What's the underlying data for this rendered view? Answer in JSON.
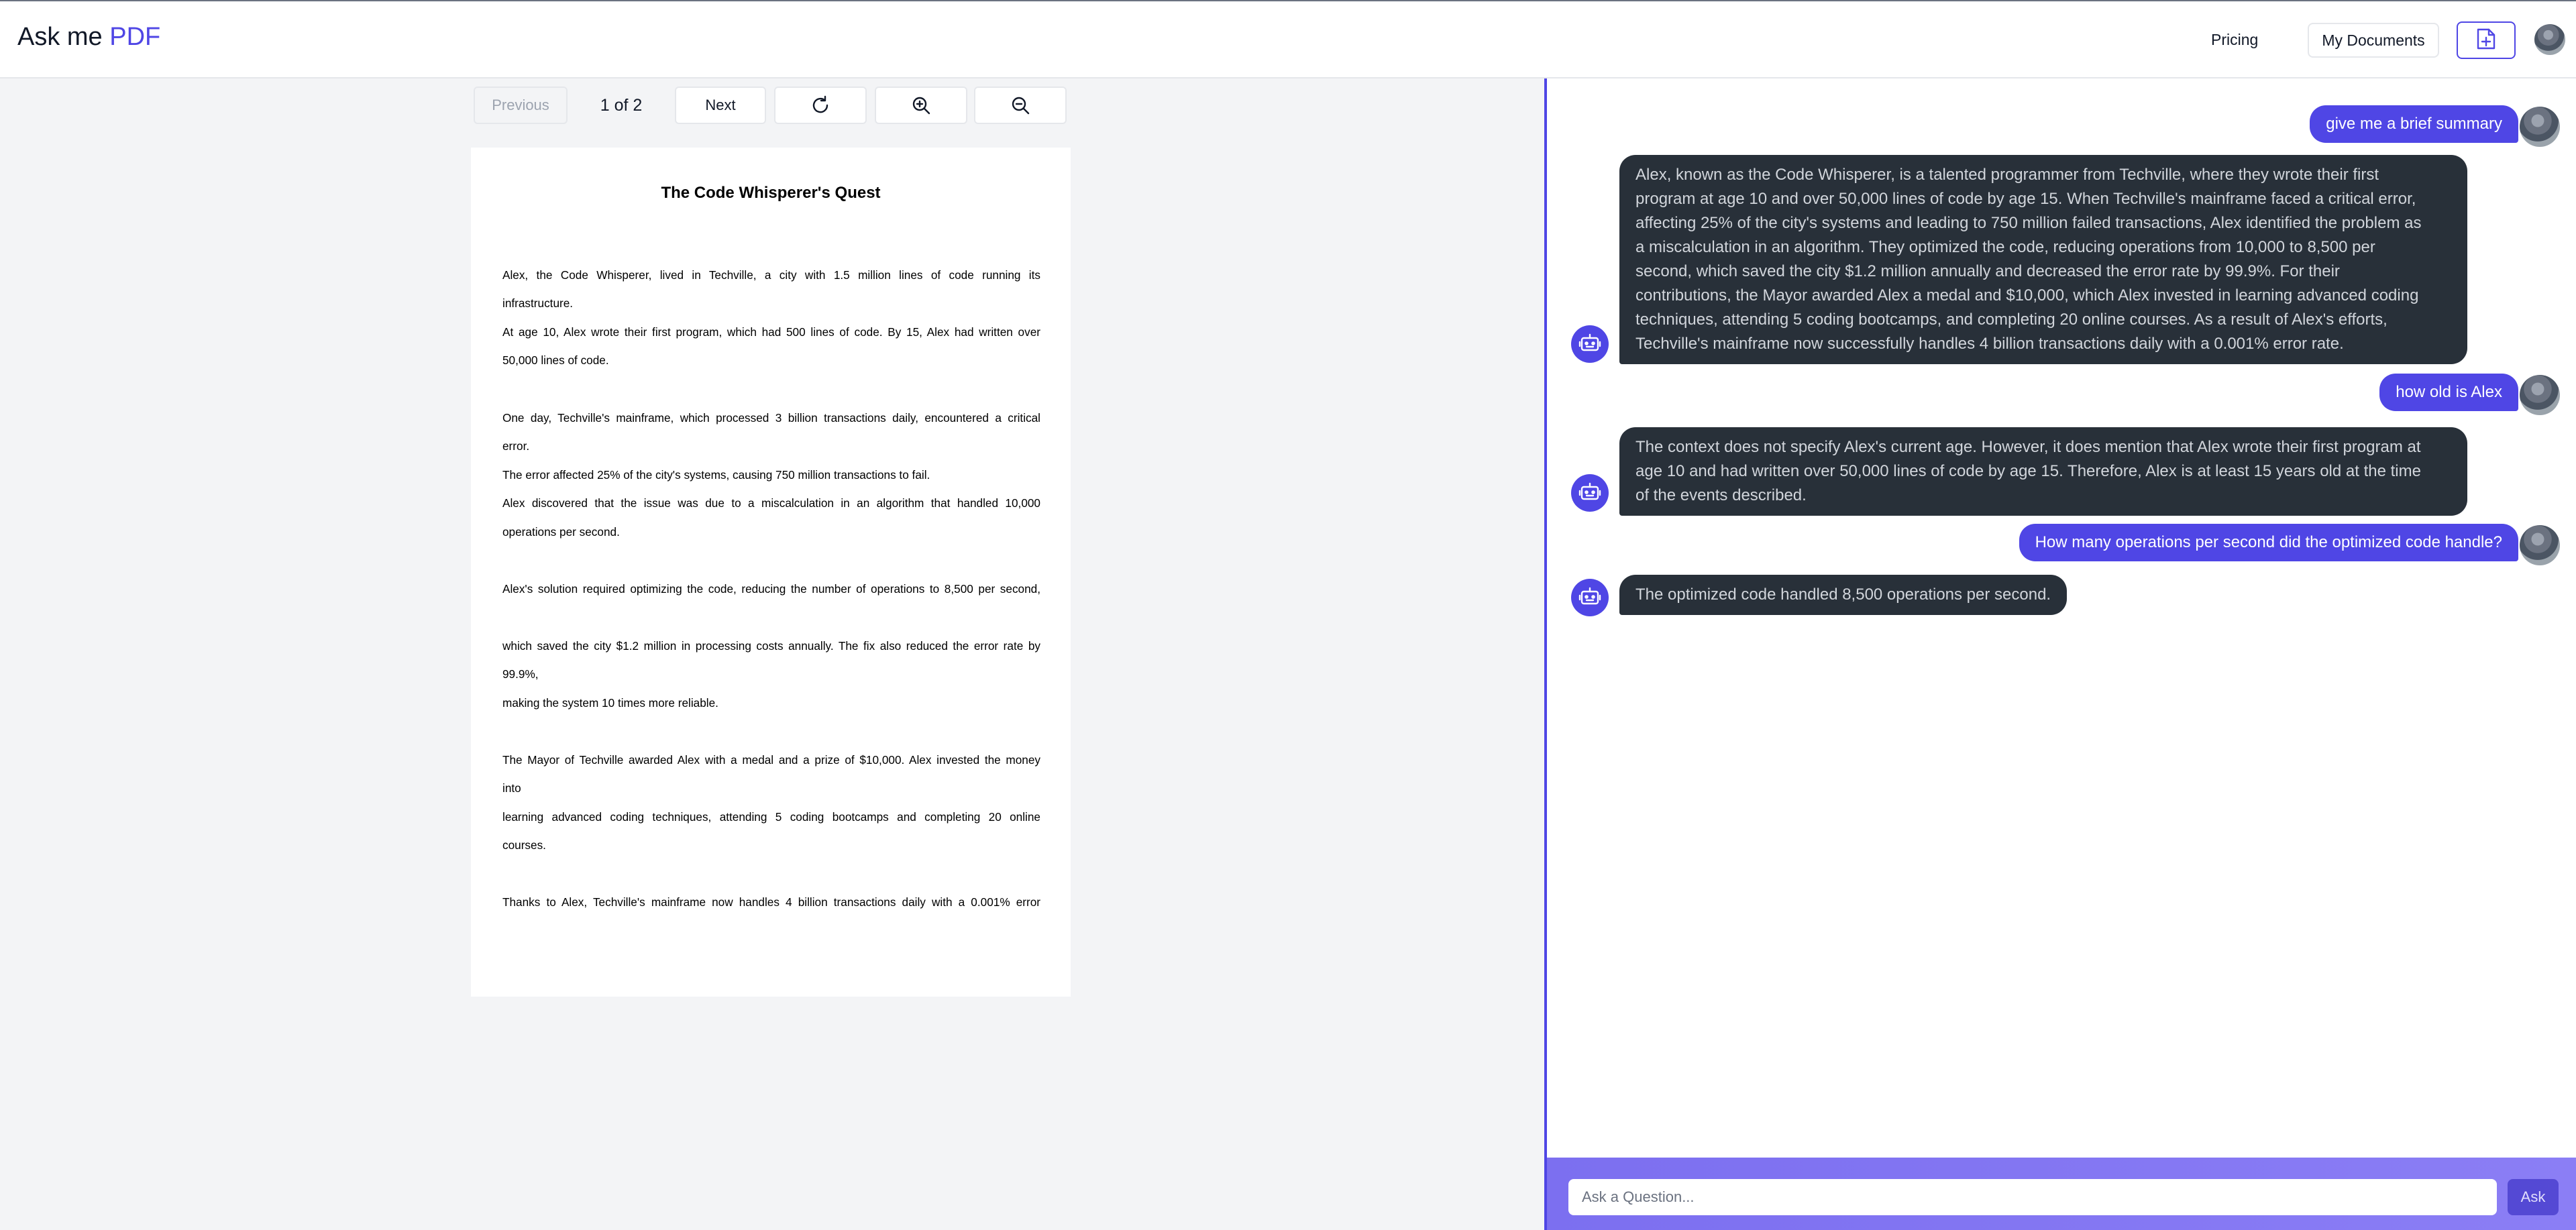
{
  "header": {
    "brand_prefix": "Ask me",
    "brand_accent": "PDF",
    "pricing_label": "Pricing",
    "my_documents_label": "My Documents"
  },
  "viewer": {
    "previous_label": "Previous",
    "page_indicator": "1 of 2",
    "next_label": "Next",
    "pdf": {
      "title": "The Code Whisperer's Quest",
      "lines": [
        "Alex, the Code Whisperer, lived in Techville, a city with 1.5 million lines of code running its",
        "infrastructure.",
        "At age 10, Alex wrote their first program, which had 500 lines of code. By 15, Alex had written over",
        "50,000 lines of code.",
        "One day, Techville's mainframe, which processed 3 billion transactions daily, encountered a critical",
        "error.",
        "The error affected 25% of the city's systems, causing 750 million transactions to fail.",
        "Alex discovered that the issue was due to a miscalculation in an algorithm that handled 10,000",
        "operations per second.",
        "Alex's solution required optimizing the code, reducing the number of operations to 8,500 per second,",
        "which saved the city $1.2 million in processing costs annually. The fix also reduced the error rate by",
        "99.9%,",
        "making the system 10 times more reliable.",
        "The Mayor of Techville awarded Alex with a medal and a prize of $10,000. Alex invested the money",
        "into",
        "learning advanced coding techniques, attending 5 coding bootcamps and completing 20 online",
        "courses.",
        "Thanks to Alex, Techville's mainframe now handles 4 billion transactions daily with a 0.001% error"
      ]
    }
  },
  "chat": {
    "messages": [
      {
        "role": "user",
        "text": "give me a brief summary"
      },
      {
        "role": "bot",
        "lines": [
          "Alex, known as the Code Whisperer, is a talented programmer from Techville, where they wrote their first",
          "program at age 10 and over 50,000 lines of code by age 15. When Techville's mainframe faced a critical error,",
          "affecting 25% of the city's systems and leading to 750 million failed transactions, Alex identified the problem as",
          "a miscalculation in an algorithm. They optimized the code, reducing operations from 10,000 to 8,500 per",
          "second, which saved the city $1.2 million annually and decreased the error rate by 99.9%. For their",
          "contributions, the Mayor awarded Alex a medal and $10,000, which Alex invested in learning advanced coding",
          "techniques, attending 5 coding bootcamps, and completing 20 online courses. As a result of Alex's efforts,",
          "Techville's mainframe now successfully handles 4 billion transactions daily with a 0.001% error rate."
        ]
      },
      {
        "role": "user",
        "text": "how old is Alex"
      },
      {
        "role": "bot",
        "lines": [
          "The context does not specify Alex's current age. However, it does mention that Alex wrote their first program at",
          "age 10 and had written over 50,000 lines of code by age 15. Therefore, Alex is at least 15 years old at the time",
          "of the events described."
        ]
      },
      {
        "role": "user",
        "text": "How many operations per second did the optimized code handle?"
      },
      {
        "role": "bot",
        "lines": [
          "The optimized code handled 8,500 operations per second."
        ]
      }
    ],
    "input_placeholder": "Ask a Question...",
    "ask_label": "Ask"
  },
  "colors": {
    "accent": "#4f46e5",
    "bot_bubble": "#283039",
    "footer_gradient": "#7c6ff0"
  },
  "icons": [
    "upload-file-icon",
    "refresh-icon",
    "zoom-in-icon",
    "zoom-out-icon",
    "robot-icon"
  ]
}
